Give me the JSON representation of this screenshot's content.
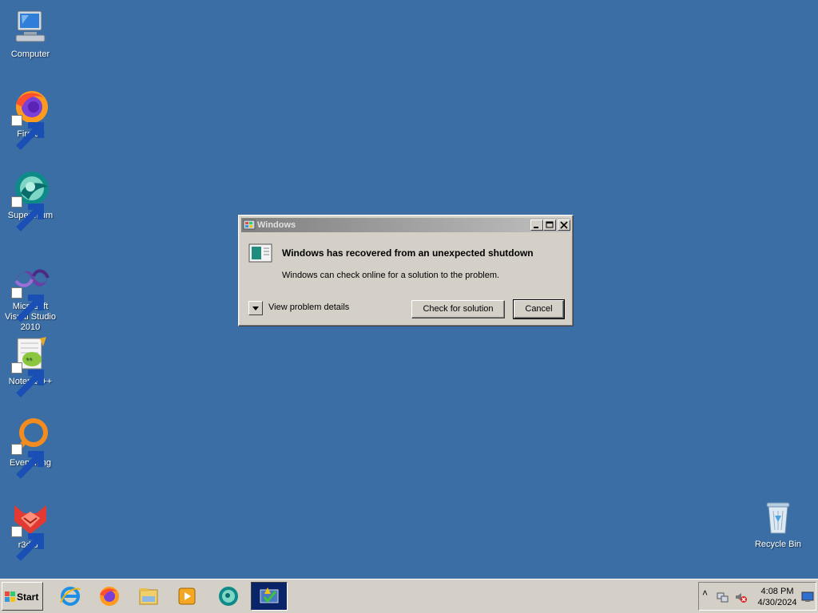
{
  "desktop": {
    "icons": [
      {
        "label": "Computer",
        "icon": "computer-icon"
      },
      {
        "label": "Firefox",
        "icon": "firefox-icon"
      },
      {
        "label": "Supermium",
        "icon": "supermium-icon"
      },
      {
        "label": "Microsoft Visual Studio 2010",
        "icon": "visual-studio-icon"
      },
      {
        "label": "Notepad++",
        "icon": "notepadpp-icon"
      },
      {
        "label": "Everything",
        "icon": "everything-icon"
      },
      {
        "label": "r3dfox",
        "icon": "r3dfox-icon"
      },
      {
        "label": "Recycle Bin",
        "icon": "recycle-bin-icon"
      }
    ],
    "background_color": "#3a6ea5"
  },
  "dialog": {
    "title": "Windows",
    "heading": "Windows has recovered from an unexpected shutdown",
    "message": "Windows can check online for a solution to the problem.",
    "details_label": "View problem details",
    "check_button": "Check for solution",
    "cancel_button": "Cancel"
  },
  "taskbar": {
    "start_label": "Start",
    "apps": [
      "internet-explorer-icon",
      "firefox-icon",
      "file-explorer-icon",
      "media-player-icon",
      "supermium-icon",
      "action-center-icon"
    ],
    "tray": {
      "time": "4:08 PM",
      "date": "4/30/2024",
      "expand_glyph": "˄"
    }
  }
}
